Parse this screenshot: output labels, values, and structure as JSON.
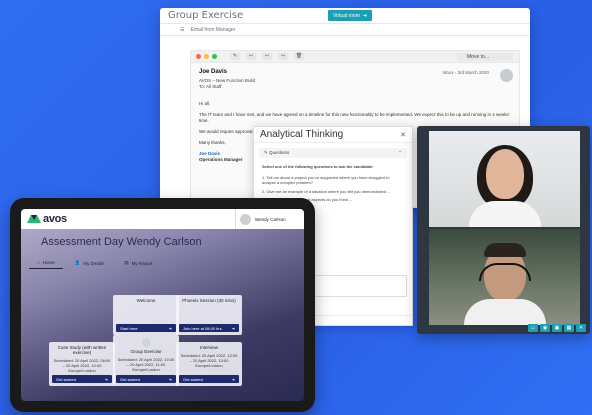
{
  "email": {
    "title": "Group Exercise",
    "virtual_room": "Virtual room",
    "email_from_manager": "Email from Manager",
    "move_to": "Move to...",
    "from": "Joe Davis",
    "subject": "AVOS – New Function Build",
    "to": "To: All Staff",
    "inbox": "Inbox - 3rd March 2020",
    "greeting": "Hi all,",
    "p1": "The IT team and I have met, and we have agreed on a timeline for this new functionality to be implemented. We expect this to be up and running in 4 weeks' time.",
    "p2": "We would require approval ... training. If you have be... and for being so patient...",
    "thanks": "Many thanks,",
    "sign_name": "Joe Davis",
    "sign_title": "Operations Manager"
  },
  "analytical": {
    "title": "Analytical Thinking",
    "questions": "Questions",
    "instruction": "Select one of the following questions to ask the candidate:",
    "q1": "1. Tell me about a project you've supported where you have struggled to analyse a complex problem?",
    "q2": "2. Give me an example of a situation where you felt you demonstrated ...",
    "line3": "... selected challenge, what aspects do you think ...",
    "line4": "... your decision and why?",
    "line5": "... select once the objective?",
    "line6": "... specific example?",
    "line7": "... the grey box below."
  },
  "tablet": {
    "brand": "avos",
    "user_name": "Wendy Carlson",
    "heading_prefix": "Assessment Day",
    "heading_name": "Wendy Carlson",
    "tabs": [
      "Home",
      "My Details",
      "My Report"
    ],
    "cards": [
      {
        "title": "Welcome",
        "desc": "",
        "button": "Start here"
      },
      {
        "title": "Phoenix Session (30 mins)",
        "desc": "",
        "button": "Join here at 08:00 hrs"
      },
      {
        "title": "Case Study (with written exercise)",
        "desc": "Scheduled: 20 April 2022, 08:00 – 20 April 2022, 10:00 Europe/London",
        "button": "Get started"
      },
      {
        "title": "Group Exercise",
        "desc": "Scheduled: 20 April 2022, 10:30 – 20 April 2022, 11:00 Europe/London",
        "button": "Get started"
      },
      {
        "title": "Interview",
        "desc": "Scheduled: 20 April 2022, 12:00 – 20 April 2022, 13:00 Europe/London",
        "button": "Get started"
      }
    ]
  },
  "colors": {
    "background": "#2563eb",
    "teal": "#1a9fb5",
    "navy": "#1f2a6e"
  }
}
